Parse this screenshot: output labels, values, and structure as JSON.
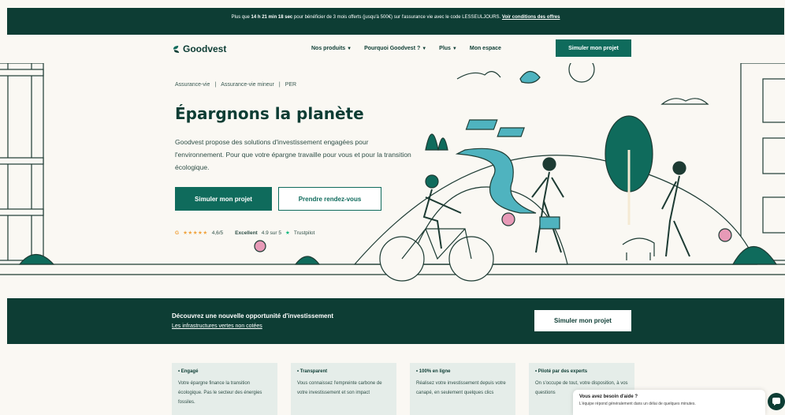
{
  "promo": {
    "text_before": "Plus que ",
    "countdown": "14 h 21 min 18 sec",
    "text_after": " pour bénéficier de 3 mois offerts (jusqu'à 500€) sur l'assurance vie avec le code LESSEULJOURS.",
    "link": "Voir conditions des offres"
  },
  "nav": {
    "logo": "Goodvest",
    "items": [
      {
        "label": "Nos produits",
        "chevron": true
      },
      {
        "label": "Pourquoi Goodvest ?",
        "chevron": true
      },
      {
        "label": "Plus",
        "chevron": true
      },
      {
        "label": "Mon espace",
        "chevron": false
      }
    ],
    "cta": "Simuler mon projet"
  },
  "breadcrumb": [
    "Assurance-vie",
    "|",
    "Assurance-vie mineur",
    "|",
    "PER"
  ],
  "hero": {
    "title": "Épargnons la planète",
    "text": "Goodvest propose des solutions d'investissement engagées pour l'environnement. Pour que votre épargne travaille pour vous et pour la transition écologique.",
    "primary_button": "Simuler mon projet",
    "secondary_button": "Prendre rendez-vous"
  },
  "rating": {
    "prefix": "G",
    "stars": "★★★★★",
    "score": "4,6/5",
    "label": "Excellent",
    "tp_score": "4.9 sur 5",
    "tp_brand": "Trustpilot"
  },
  "banner": {
    "title": "Découvrez une nouvelle opportunité d'investissement",
    "link": "Les infrastructures vertes non cotées",
    "button": "Simuler mon projet"
  },
  "features": [
    {
      "title": "• Engagé",
      "text": "Votre épargne finance la transition écologique. Pas le secteur des énergies fossiles."
    },
    {
      "title": "• Transparent",
      "text": "Vous connaissez l'empreinte carbone de votre investissement et son impact"
    },
    {
      "title": "• 100% en ligne",
      "text": "Réalisez votre investissement depuis votre canapé, en seulement quelques clics"
    },
    {
      "title": "• Piloté par des experts",
      "text": "On s'occupe de tout, votre disposition, à vos questions"
    }
  ],
  "chat": {
    "title": "Vous avez besoin d'aide ?",
    "subtitle": "L'équipe répond généralement dans un délai de quelques minutes."
  },
  "colors": {
    "dark_green": "#0d3d34",
    "primary_green": "#0f6b5c",
    "teal": "#4fb3bf",
    "background": "#faf8f3"
  }
}
